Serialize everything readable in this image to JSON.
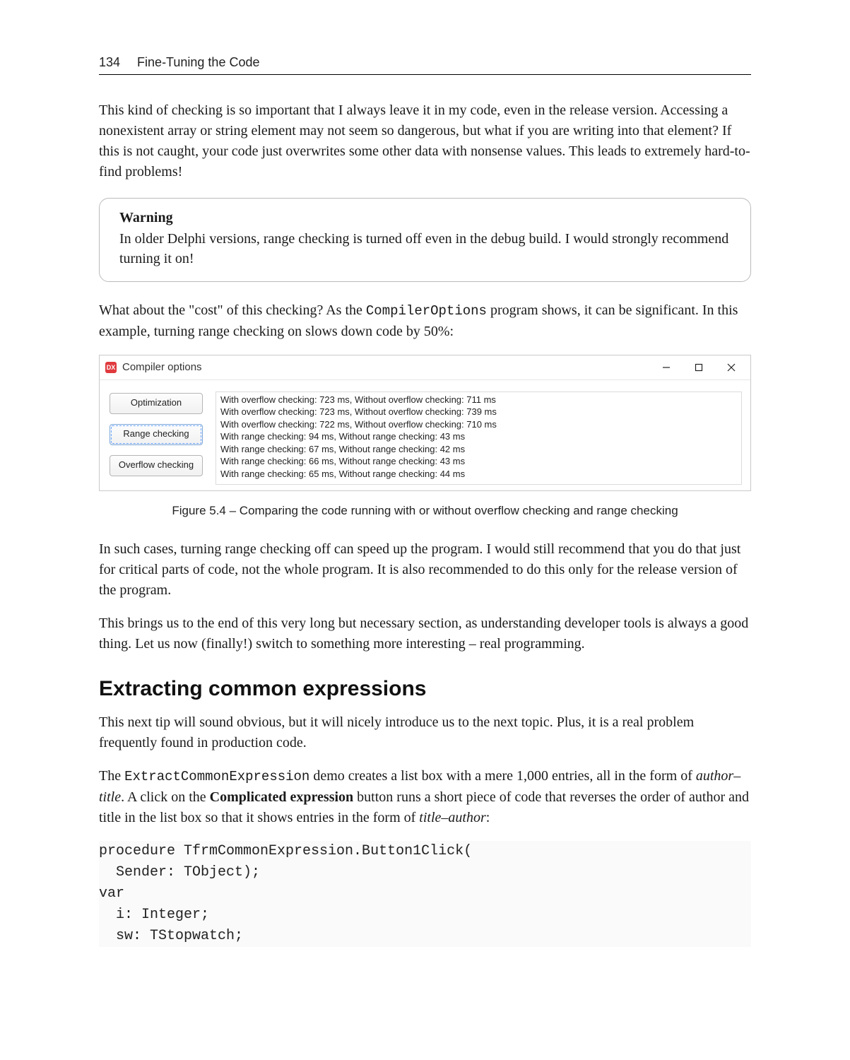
{
  "header": {
    "page_number": "134",
    "chapter": "Fine-Tuning the Code"
  },
  "paragraphs": {
    "p1": "This kind of checking is so important that I always leave it in my code, even in the release version. Accessing a nonexistent array or string element may not seem so dangerous, but what if you are writing into that element? If this is not caught, your code just overwrites some other data with nonsense values. This leads to extremely hard-to-find problems!",
    "p2a": "What about the \"cost\" of this checking? As the ",
    "p2_mono": "CompilerOptions",
    "p2b": " program shows, it can be significant. In this example, turning range checking on slows down code by 50%:",
    "p3": "In such cases, turning range checking off can speed up the program. I would still recommend that you do that just for critical parts of code, not the whole program. It is also recommended to do this only for the release version of the program.",
    "p4": "This brings us to the end of this very long but necessary section, as understanding developer tools is always a good thing. Let us now (finally!) switch to something more interesting – real programming.",
    "p5": "This next tip will sound obvious, but it will nicely introduce us to the next topic. Plus, it is a real problem frequently found in production code.",
    "p6a": "The ",
    "p6_mono": "ExtractCommonExpression",
    "p6b": " demo creates a list box with a mere 1,000 entries, all in the form of ",
    "p6_it1": "author–title",
    "p6c": ". A click on the ",
    "p6_bold": "Complicated expression",
    "p6d": " button runs a short piece of code that reverses the order of author and title in the list box so that it shows entries in the form of ",
    "p6_it2": "title–author",
    "p6e": ":"
  },
  "callout": {
    "title": "Warning",
    "body": "In older Delphi versions, range checking is turned off even in the debug build. I would strongly recommend turning it on!"
  },
  "window": {
    "icon_text": "DX",
    "title": "Compiler options",
    "buttons": {
      "optimization": "Optimization",
      "range": "Range checking",
      "overflow": "Overflow checking"
    },
    "output_lines": [
      "With overflow checking: 723 ms, Without overflow checking: 711 ms",
      "With overflow checking: 723 ms, Without overflow checking: 739 ms",
      "With overflow checking: 722 ms, Without overflow checking: 710 ms",
      "With range checking: 94 ms, Without range checking: 43 ms",
      "With range checking: 67 ms, Without range checking: 42 ms",
      "With range checking: 66 ms, Without range checking: 43 ms",
      "With range checking: 65 ms, Without range checking: 44 ms"
    ]
  },
  "figure_caption": "Figure 5.4 – Comparing the code running with or without overflow checking and range checking",
  "section_heading": "Extracting common expressions",
  "code": "procedure TfrmCommonExpression.Button1Click(\n  Sender: TObject);\nvar\n  i: Integer;\n  sw: TStopwatch;"
}
